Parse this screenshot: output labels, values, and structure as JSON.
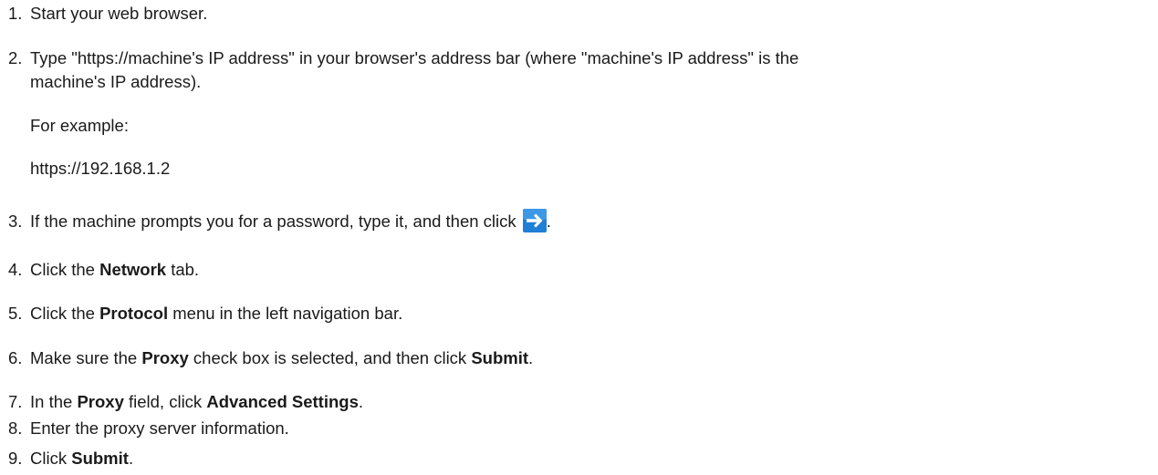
{
  "steps": [
    {
      "num": "1.",
      "text": "Start your web browser."
    },
    {
      "num": "2.",
      "line1": "Type \"https://machine's IP address\" in your browser's address bar (where \"machine's IP address\" is the",
      "line2": "machine's IP address)."
    },
    {
      "num": "3.",
      "pre": "If the machine prompts you for a password, type it, and then click ",
      "post": "."
    },
    {
      "num": "4.",
      "pre": "Click the ",
      "bold": "Network",
      "post": " tab."
    },
    {
      "num": "5.",
      "pre": "Click the ",
      "bold": "Protocol",
      "post": " menu in the left navigation bar."
    },
    {
      "num": "6.",
      "pre": "Make sure the ",
      "bold1": "Proxy",
      "mid": " check box is selected, and then click ",
      "bold2": "Submit",
      "post": "."
    },
    {
      "num": "7.",
      "pre": "In the ",
      "bold1": "Proxy",
      "mid": " field, click ",
      "bold2": "Advanced Settings",
      "post": "."
    },
    {
      "num": "8.",
      "text": "Enter the proxy server information."
    },
    {
      "num": "9.",
      "pre": "Click ",
      "bold": "Submit",
      "post": "."
    }
  ],
  "example": {
    "label": "For example:",
    "url": "https://192.168.1.2"
  },
  "colors": {
    "arrow_bg": "#1f7fd6",
    "arrow_fg": "#ffffff"
  },
  "icons": {
    "go_button": "arrow-right-icon"
  }
}
